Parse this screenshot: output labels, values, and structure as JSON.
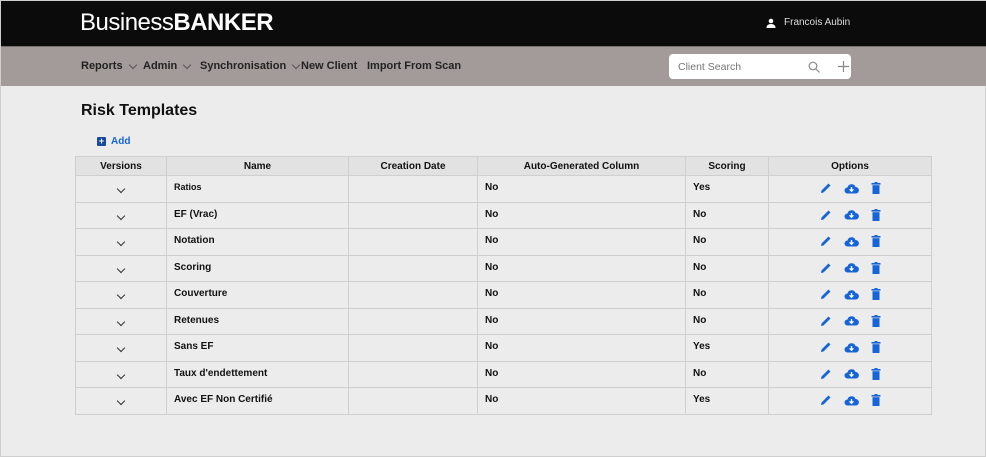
{
  "header": {
    "logo_light": "Business",
    "logo_bold": "BANKER",
    "user": "Francois Aubin"
  },
  "nav": {
    "items": [
      {
        "label": "Reports"
      },
      {
        "label": "Admin"
      },
      {
        "label": "Synchronisation"
      },
      {
        "label": "New Client"
      },
      {
        "label": "Import From Scan"
      }
    ],
    "search_placeholder": "Client Search"
  },
  "page": {
    "title": "Risk Templates",
    "add_label": "Add"
  },
  "table": {
    "columns": [
      "Versions",
      "Name",
      "Creation Date",
      "Auto-Generated Column",
      "Scoring",
      "Options"
    ],
    "rows": [
      {
        "name": "Ratios",
        "date": "",
        "auto": "No",
        "scoring": "Yes"
      },
      {
        "name": "EF (Vrac)",
        "date": "",
        "auto": "No",
        "scoring": "No"
      },
      {
        "name": "Notation",
        "date": "",
        "auto": "No",
        "scoring": "No"
      },
      {
        "name": "Scoring",
        "date": "",
        "auto": "No",
        "scoring": "No"
      },
      {
        "name": "Couverture",
        "date": "",
        "auto": "No",
        "scoring": "No"
      },
      {
        "name": "Retenues",
        "date": "",
        "auto": "No",
        "scoring": "No"
      },
      {
        "name": "Sans EF",
        "date": "",
        "auto": "No",
        "scoring": "Yes"
      },
      {
        "name": "Taux d'endettement",
        "date": "",
        "auto": "No",
        "scoring": "No"
      },
      {
        "name": "Avec EF Non Certifié",
        "date": "",
        "auto": "No",
        "scoring": "Yes"
      }
    ]
  },
  "colors": {
    "accent": "#1565d8",
    "nav": "#a39a9a",
    "header": "#0b0b0b"
  }
}
